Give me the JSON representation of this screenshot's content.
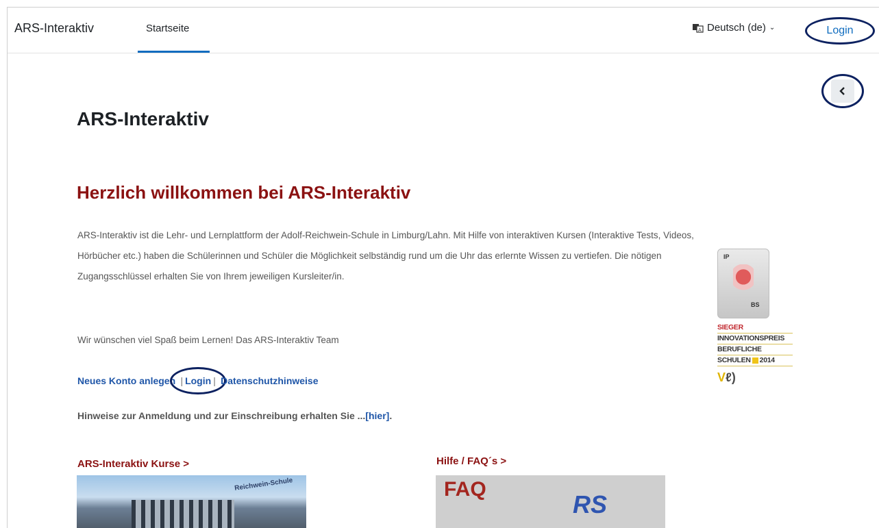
{
  "navbar": {
    "brand": "ARS-Interaktiv",
    "tab_home": "Startseite",
    "language": "Deutsch (de)",
    "login": "Login"
  },
  "main": {
    "page_title": "ARS-Interaktiv",
    "welcome_heading": "Herzlich willkommen bei ARS-Interaktiv",
    "intro": "ARS-Interaktiv ist die Lehr- und Lernplattform der Adolf-Reichwein-Schule in Limburg/Lahn. Mit Hilfe von interaktiven Kursen (Interaktive Tests, Videos, Hörbücher etc.) haben die Schülerinnen und Schüler die Möglichkeit selbständig rund um die Uhr das erlernte Wissen zu vertiefen. Die nötigen Zugangsschlüssel erhalten Sie von Ihrem jeweiligen Kursleiter/in.",
    "wish": "Wir wünschen viel Spaß beim Lernen! Das ARS-Interaktiv Team",
    "links": {
      "new_account": "Neues Konto anlegen",
      "sep": "|",
      "login": "Login",
      "privacy": "Datenschutzhinweise"
    },
    "hints_text": "Hinweise zur Anmeldung und zur Einschreibung erhalten Sie ...",
    "hints_link": "[hier]",
    "hints_end": "."
  },
  "award": {
    "key_top": "IP",
    "key_bottom": "BS",
    "line1": "SIEGER",
    "line2": "INNOVATIONSPREIS",
    "line3": "BERUFLICHE",
    "line4": "SCHULEN",
    "year": "2014"
  },
  "sections": [
    {
      "title": "ARS-Interaktiv Kurse >",
      "image_text": "Reichwein-Schule"
    },
    {
      "title": "Hilfe / FAQ´s >",
      "image_text": "FAQ",
      "image_text2": "RS"
    }
  ],
  "colors": {
    "accent": "#0f6cbf",
    "heading_red": "#8b1212",
    "annotation": "#0c2160"
  }
}
